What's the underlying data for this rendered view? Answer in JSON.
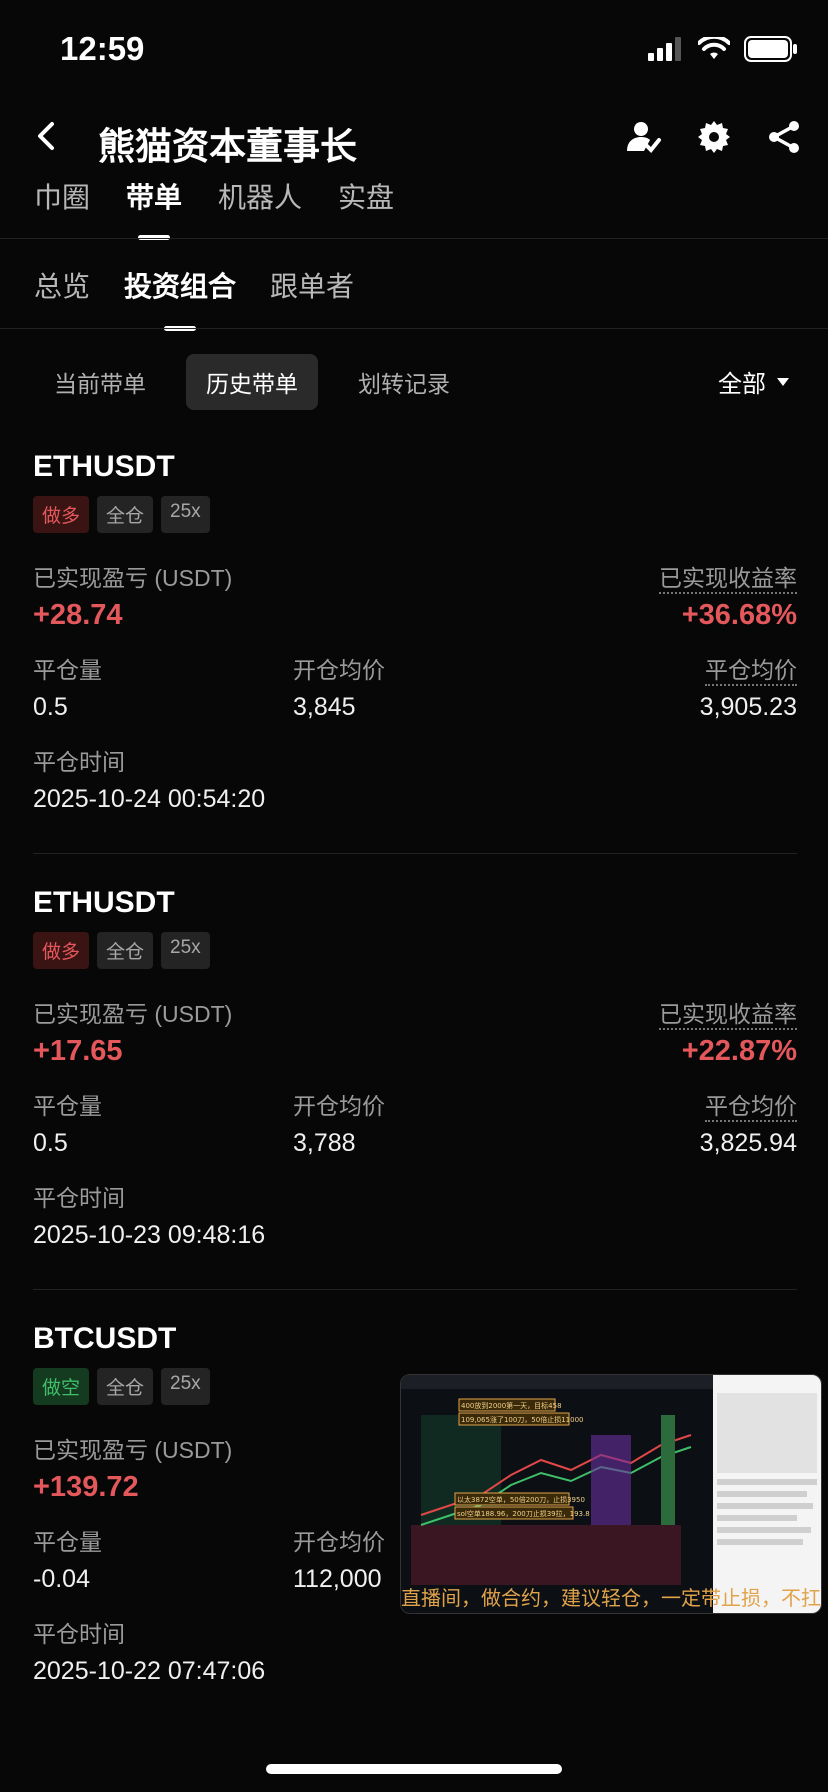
{
  "status_bar": {
    "time": "12:59"
  },
  "header": {
    "title": "熊猫资本董事长"
  },
  "tabs_primary": [
    {
      "label": "巾圈",
      "active": false
    },
    {
      "label": "带单",
      "active": true
    },
    {
      "label": "机器人",
      "active": false
    },
    {
      "label": "实盘",
      "active": false
    }
  ],
  "tabs_secondary": [
    {
      "label": "总览",
      "active": false
    },
    {
      "label": "投资组合",
      "active": true
    },
    {
      "label": "跟单者",
      "active": false
    }
  ],
  "pills": [
    {
      "label": "当前带单",
      "active": false
    },
    {
      "label": "历史带单",
      "active": true
    },
    {
      "label": "划转记录",
      "active": false
    }
  ],
  "filter": {
    "label": "全部"
  },
  "labels": {
    "realized_pnl": "已实现盈亏 (USDT)",
    "realized_rate": "已实现收益率",
    "close_qty": "平仓量",
    "open_avg": "开仓均价",
    "close_avg": "平仓均价",
    "close_time": "平仓时间"
  },
  "trades": [
    {
      "symbol": "ETHUSDT",
      "side": "做多",
      "margin": "全仓",
      "leverage": "25x",
      "pnl": "+28.74",
      "rate": "+36.68%",
      "close_qty": "0.5",
      "open_avg": "3,845",
      "close_avg": "3,905.23",
      "close_time": "2025-10-24 00:54:20"
    },
    {
      "symbol": "ETHUSDT",
      "side": "做多",
      "margin": "全仓",
      "leverage": "25x",
      "pnl": "+17.65",
      "rate": "+22.87%",
      "close_qty": "0.5",
      "open_avg": "3,788",
      "close_avg": "3,825.94",
      "close_time": "2025-10-23 09:48:16"
    },
    {
      "symbol": "BTCUSDT",
      "side": "做空",
      "margin": "全仓",
      "leverage": "25x",
      "pnl": "+139.72",
      "close_qty": "-0.04",
      "open_avg": "112,000",
      "close_time": "2025-10-22 07:47:06"
    }
  ],
  "pip": {
    "caption": "直播间，做合约，建议轻仓，一定带止损，不扛单",
    "notes": [
      "400放到2000第一天，目标458",
      "109,065涨了100刀，50倍止损11000",
      "以太3872空单，50倍200刀，止损3950",
      "sol空单188.96，200刀止损39拉，193.8"
    ]
  },
  "colors": {
    "up": "#e4585c",
    "down": "#3fbf6a",
    "bg": "#070707"
  }
}
